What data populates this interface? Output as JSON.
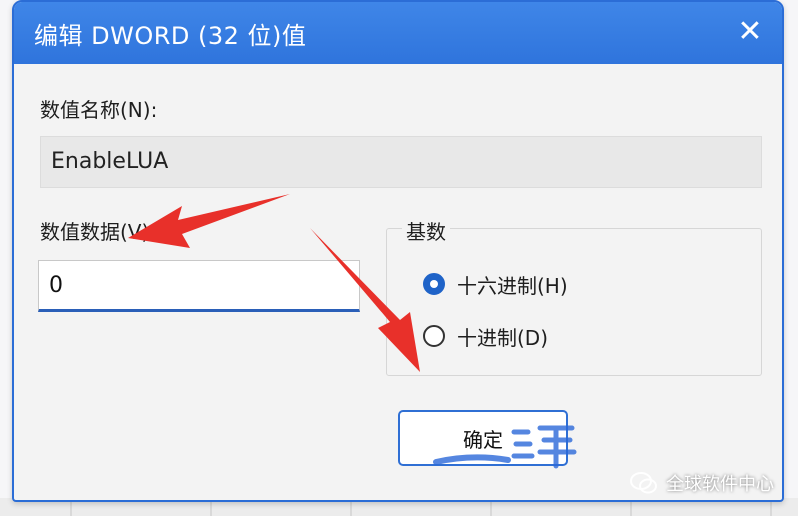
{
  "window": {
    "title": "编辑 DWORD (32 位)值",
    "close_glyph": "✕"
  },
  "value_name": {
    "label": "数值名称(N):",
    "value": "EnableLUA"
  },
  "value_data": {
    "label": "数值数据(V):",
    "value": "0"
  },
  "base": {
    "label": "基数",
    "options": [
      {
        "label": "十六进制(H)",
        "checked": true
      },
      {
        "label": "十进制(D)",
        "checked": false
      }
    ]
  },
  "buttons": {
    "ok_label": "确定"
  },
  "watermark": {
    "text": "全球软件中心",
    "icon": "wechat-icon"
  },
  "colors": {
    "accent": "#2f74dc",
    "arrow": "#e8302a"
  }
}
